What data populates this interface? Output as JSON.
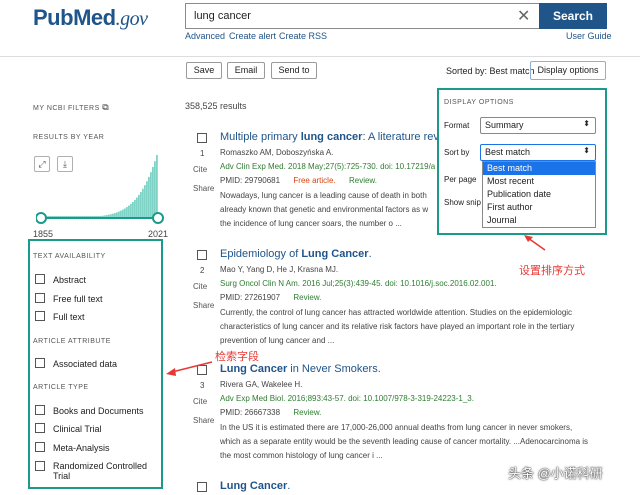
{
  "header": {
    "logo_pub": "Pub",
    "logo_med": "Med",
    "logo_gov": ".gov",
    "search_value": "lung cancer",
    "search_button": "Search",
    "links": [
      "Advanced",
      "Create alert",
      "Create RSS"
    ],
    "user_guide": "User Guide"
  },
  "toolbar": {
    "save": "Save",
    "email": "Email",
    "send_to": "Send to",
    "sorted_by": "Sorted by: Best match",
    "display_options": "Display options"
  },
  "sidebar": {
    "ncbi_filters": "MY NCBI FILTERS",
    "results_by_year": "RESULTS BY YEAR",
    "year_start": "1855",
    "year_end": "2021",
    "text_availability": "TEXT AVAILABILITY",
    "text_items": [
      "Abstract",
      "Free full text",
      "Full text"
    ],
    "article_attribute": "ARTICLE ATTRIBUTE",
    "attribute_items": [
      "Associated data"
    ],
    "article_type": "ARTICLE TYPE",
    "type_items": [
      "Books and Documents",
      "Clinical Trial",
      "Meta-Analysis",
      "Randomized Controlled Trial"
    ]
  },
  "results": {
    "count": "358,525 results",
    "cite": "Cite",
    "share": "Share",
    "items": [
      {
        "num": "1",
        "title_pre": "Multiple primary ",
        "title_bold": "lung cancer",
        "title_post": ": A literature revi",
        "authors": "Romaszko AM, Doboszyńska A.",
        "journal": "Adv Clin Exp Med. 2018 May;27(5):725-730. doi: 10.17219/a",
        "pmid": "PMID: 29790681",
        "free": "Free article.",
        "review": "Review.",
        "snip1": "Nowadays, lung cancer is a leading cause of death in both",
        "snip2": "already known that genetic and environmental factors as w",
        "snip3": "the incidence of lung cancer soars, the number o ..."
      },
      {
        "num": "2",
        "title_pre": "Epidemiology of ",
        "title_bold": "Lung Cancer",
        "title_post": ".",
        "authors": "Mao Y, Yang D, He J, Krasna MJ.",
        "journal": "Surg Oncol Clin N Am. 2016 Jul;25(3):439-45. doi: 10.1016/j.soc.2016.02.001.",
        "pmid": "PMID: 27261907",
        "free": "",
        "review": "Review.",
        "snip1": "Currently, the control of lung cancer has attracted worldwide attention. Studies on the epidemiologic",
        "snip2": "characteristics of lung cancer and its relative risk factors have played an important role in the tertiary",
        "snip3": "prevention of lung cancer and ..."
      },
      {
        "num": "3",
        "title_pre": "",
        "title_bold": "Lung Cancer",
        "title_post": " in Never Smokers.",
        "authors": "Rivera GA, Wakelee H.",
        "journal": "Adv Exp Med Biol. 2016;893:43-57. doi: 10.1007/978-3-319-24223-1_3.",
        "pmid": "PMID: 26667338",
        "free": "",
        "review": "Review.",
        "snip1": "In the US it is estimated there are 17,000-26,000 annual deaths from lung cancer in never smokers,",
        "snip2": "which as a separate entity would be the seventh leading cause of cancer mortality. ...Adenocarcinoma is",
        "snip3": "the most common histology of lung cancer i ..."
      },
      {
        "num": "",
        "title_pre": "",
        "title_bold": "Lung Cancer",
        "title_post": ".",
        "authors": "",
        "journal": "",
        "pmid": "",
        "free": "",
        "review": "",
        "snip1": "",
        "snip2": "",
        "snip3": ""
      }
    ]
  },
  "display_panel": {
    "title": "DISPLAY OPTIONS",
    "format_label": "Format",
    "format_value": "Summary",
    "sort_label": "Sort by",
    "sort_value": "Best match",
    "per_page_label": "Per page",
    "show_snippets_label": "Show snip",
    "sort_options": [
      "Best match",
      "Most recent",
      "Publication date",
      "First author",
      "Journal"
    ]
  },
  "annotations": {
    "sort_note": "设置排序方式",
    "filter_note": "检索字段",
    "watermark": "头条 @小诺科研"
  },
  "colors": {
    "brand": "#20558a",
    "highlight_frame": "#1b9a8a",
    "annotation": "#e53935"
  }
}
